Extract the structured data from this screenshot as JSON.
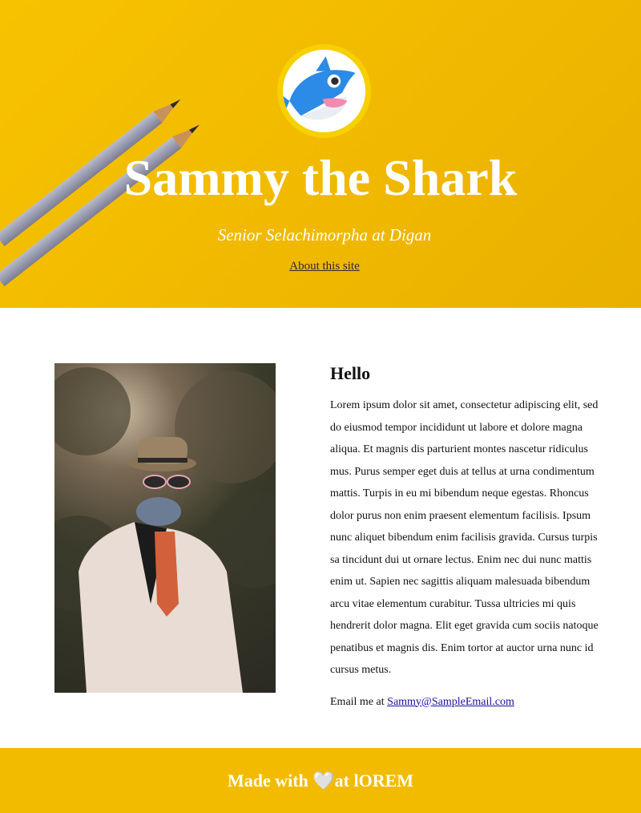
{
  "header": {
    "title": "Sammy the Shark",
    "subtitle": "Senior Selachimorpha at Digan",
    "about_link": "About this site"
  },
  "main": {
    "heading": "Hello",
    "body": "Lorem ipsum dolor sit amet, consectetur adipiscing elit, sed do eiusmod tempor incididunt ut labore et dolore magna aliqua. Et magnis dis parturient montes nascetur ridiculus mus. Purus semper eget duis at tellus at urna condimentum mattis. Turpis in eu mi bibendum neque egestas. Rhoncus dolor purus non enim praesent elementum facilisis. Ipsum nunc aliquet bibendum enim facilisis gravida. Cursus turpis sa tincidunt dui ut ornare lectus. Enim nec dui nunc mattis enim ut. Sapien nec sagittis aliquam malesuada bibendum arcu vitae elementum curabitur. Tussa ultricies mi quis hendrerit dolor magna. Elit eget gravida cum sociis natoque penatibus et magnis dis. Enim tortor at auctor urna nunc id cursus metus.",
    "email_prefix": "Email me at ",
    "email": "Sammy@SampleEmail.com"
  },
  "footer": {
    "made_with": "Made with ",
    "heart": "🤍",
    "suffix": "at lOREM"
  },
  "colors": {
    "accent": "#f2bb00",
    "hero_text": "#ffffff",
    "link": "#1a0dab"
  },
  "icons": {
    "avatar": "shark-icon",
    "heart": "heart-icon"
  }
}
